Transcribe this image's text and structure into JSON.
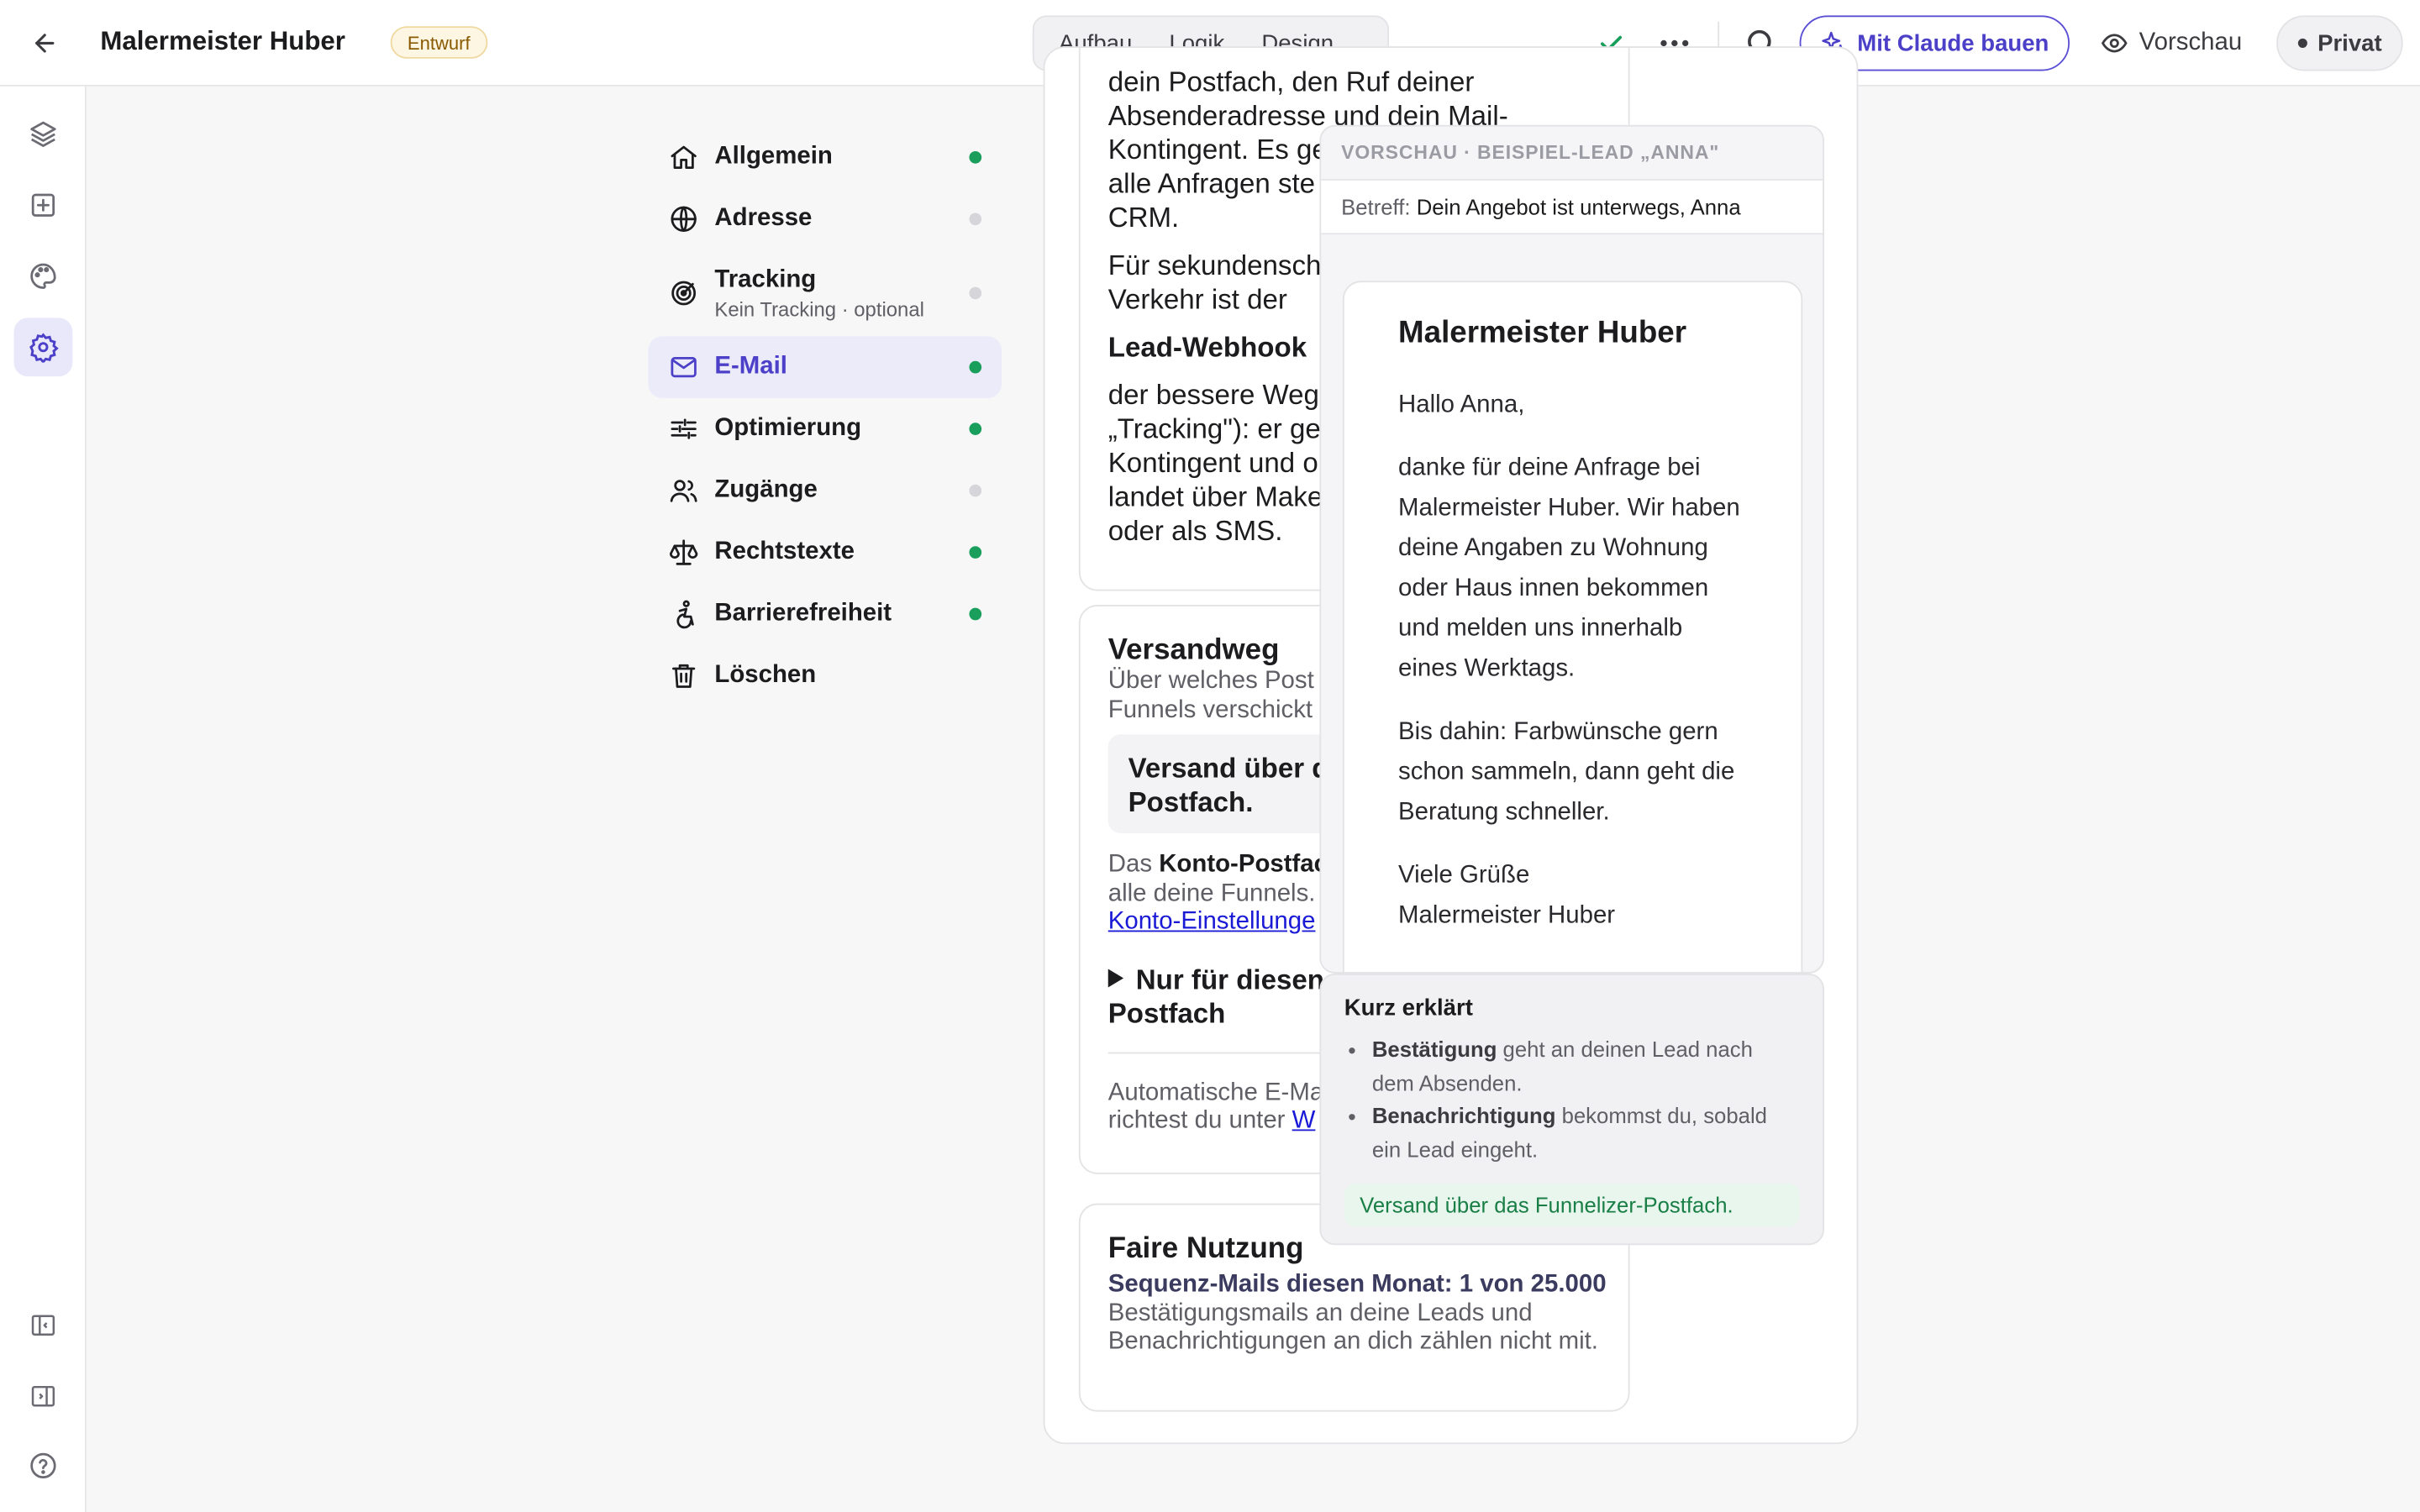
{
  "header": {
    "title": "Malermeister Huber",
    "status_badge": "Entwurf",
    "tabs": [
      "Aufbau",
      "Logik",
      "Design"
    ],
    "claude_button": "Mit Claude bauen",
    "preview_button": "Vorschau",
    "visibility_button": "Privat",
    "accent_color": "#5b4fd6"
  },
  "rail": {
    "icons": [
      "layers-icon",
      "add-square-icon",
      "palette-icon",
      "settings-gear-icon",
      "collapse-left-icon",
      "collapse-right-icon",
      "help-icon"
    ]
  },
  "settings_nav": {
    "items": [
      {
        "label": "Allgemein",
        "icon": "home-icon",
        "status": "green"
      },
      {
        "label": "Adresse",
        "icon": "globe-icon",
        "status": "grey"
      },
      {
        "label": "Tracking",
        "sub": "Kein Tracking · optional",
        "icon": "target-icon",
        "status": "grey"
      },
      {
        "label": "E-Mail",
        "icon": "mail-icon",
        "status": "green",
        "active": true
      },
      {
        "label": "Optimierung",
        "icon": "sliders-icon",
        "status": "green"
      },
      {
        "label": "Zugänge",
        "icon": "users-icon",
        "status": "grey"
      },
      {
        "label": "Rechtstexte",
        "icon": "scale-icon",
        "status": "green"
      },
      {
        "label": "Barrierefreiheit",
        "icon": "accessibility-icon",
        "status": "green"
      },
      {
        "label": "Löschen",
        "icon": "trash-icon",
        "status": "none"
      }
    ]
  },
  "card_top": {
    "line1": "dein Postfach, den Ruf deiner",
    "line2": "Absenderadresse und dein Mail-",
    "line3": "Kontingent. Es ge",
    "line4": "alle Anfragen ste",
    "line5": "CRM.",
    "line6": "Für sekundensch",
    "line7": "Verkehr ist der",
    "webhook_heading": "Lead-Webhook",
    "line8": "der bessere Weg",
    "line9": "„Tracking\"): er ge",
    "line10": "Kontingent und o",
    "line11": "landet über Make",
    "line12": "oder als SMS."
  },
  "card_versand": {
    "title": "Versandweg",
    "desc1": "Über welches Post",
    "desc2": "Funnels verschickt",
    "option_line1": "Versand über d",
    "option_line2": "Postfach.",
    "info_prefix": "Das ",
    "info_bold": "Konto-Postfac",
    "info_line2": "alle deine Funnels.",
    "info_link": "Konto-Einstellunge",
    "toggle_line1": "Nur für diesen",
    "toggle_line2": "Postfach",
    "auto_line1": "Automatische E-Ma",
    "auto_line2": "richtest du unter",
    "auto_link": "W"
  },
  "card_fair": {
    "title": "Faire Nutzung",
    "usage_bold": "Sequenz-Mails diesen Monat: 1 von 25.000",
    "usage_rest": " Bestätigungsmails an deine Leads und Benachrichtigungen an dich zählen nicht mit."
  },
  "preview": {
    "header": "VORSCHAU · BEISPIEL-LEAD „ANNA\"",
    "subject_label": "Betreff:",
    "subject": "Dein Angebot ist unterwegs, Anna",
    "company": "Malermeister Huber",
    "greeting": "Hallo Anna,",
    "body1": "danke für deine Anfrage bei Malermeister Huber. Wir haben deine Angaben zu Wohnung oder Haus innen bekommen und melden uns innerhalb eines Werktags.",
    "body2": "Bis dahin: Farbwünsche gern schon sammeln, dann geht die Beratung schneller.",
    "closing1": "Viele Grüße",
    "closing2": "Malermeister Huber"
  },
  "explain": {
    "title": "Kurz erklärt",
    "item1_bold": "Bestätigung",
    "item1_rest": " geht an deinen Lead nach dem Absenden.",
    "item2_bold": "Benachrichtigung",
    "item2_rest": " bekommst du, sobald ein Lead eingeht.",
    "note": "Versand über das Funnelizer-Postfach."
  }
}
